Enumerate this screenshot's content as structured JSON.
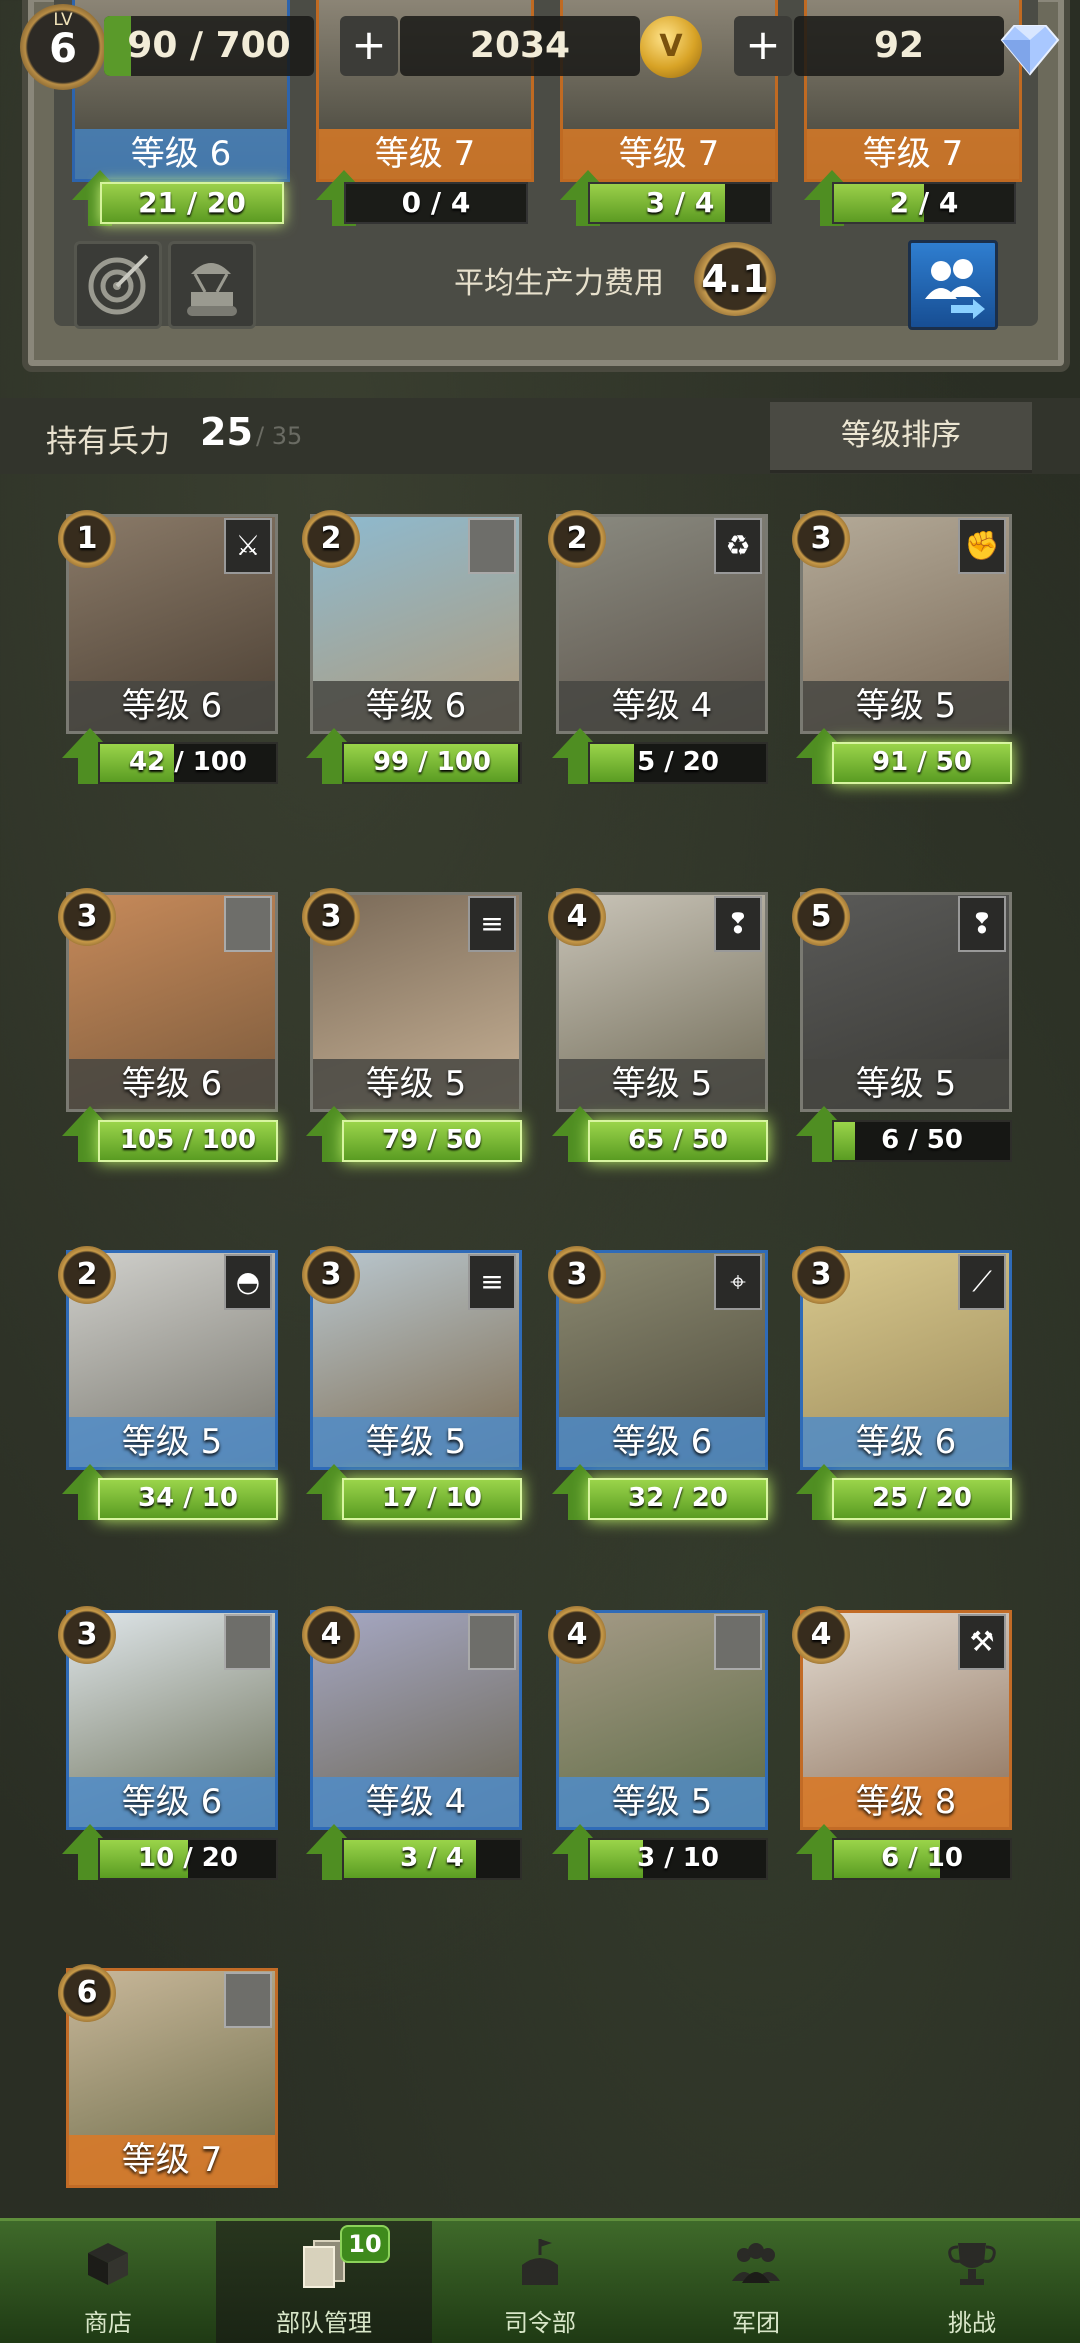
{
  "player": {
    "lv_label": "LV",
    "level": "6",
    "xp": "90 / 700",
    "xp_fraction": 0.13
  },
  "currency": {
    "gold": "2034",
    "diamonds": "92",
    "plus": "+",
    "coin_symbol": "V"
  },
  "deck": {
    "cards": [
      {
        "level": "等级 6",
        "progress": "21 / 20",
        "fraction": 1.0,
        "frame": "blue",
        "ready": true
      },
      {
        "level": "等级 7",
        "progress": "0 / 4",
        "fraction": 0.0,
        "frame": "orange",
        "ready": false
      },
      {
        "level": "等级 7",
        "progress": "3 / 4",
        "fraction": 0.75,
        "frame": "orange",
        "ready": false
      },
      {
        "level": "等级 7",
        "progress": "2 / 4",
        "fraction": 0.5,
        "frame": "orange",
        "ready": false
      }
    ],
    "cost_label": "平均生产力费用",
    "avg_cost": "4.1"
  },
  "roster": {
    "label": "持有兵力",
    "count": "25",
    "max": "/ 35",
    "sort_label": "等级排序"
  },
  "units": [
    {
      "cost": "1",
      "role": "⚔",
      "level": "等级 6",
      "progress": "42 / 100",
      "fraction": 0.42,
      "frame": "grey",
      "ready": false,
      "art": [
        "#8a7a68",
        "#4b3f33"
      ]
    },
    {
      "cost": "2",
      "role": "",
      "level": "等级 6",
      "progress": "99 / 100",
      "fraction": 0.99,
      "frame": "grey",
      "ready": false,
      "art": [
        "#8dbad0",
        "#b09a7a"
      ]
    },
    {
      "cost": "2",
      "role": "♻",
      "level": "等级 4",
      "progress": "5 / 20",
      "fraction": 0.25,
      "frame": "grey",
      "ready": false,
      "art": [
        "#8a8a80",
        "#5a5148"
      ]
    },
    {
      "cost": "3",
      "role": "✊",
      "level": "等级 5",
      "progress": "91 / 50",
      "fraction": 1.0,
      "frame": "grey",
      "ready": true,
      "art": [
        "#b4aa98",
        "#7a6a58"
      ]
    },
    {
      "cost": "3",
      "role": "",
      "level": "等级 6",
      "progress": "105 / 100",
      "fraction": 1.0,
      "frame": "grey",
      "ready": true,
      "art": [
        "#c78a5a",
        "#7a5a3c"
      ]
    },
    {
      "cost": "3",
      "role": "≡",
      "level": "等级 5",
      "progress": "79 / 50",
      "fraction": 1.0,
      "frame": "grey",
      "ready": true,
      "art": [
        "#7a6a58",
        "#c8b296"
      ]
    },
    {
      "cost": "4",
      "role": "❢",
      "level": "等级 5",
      "progress": "65 / 50",
      "fraction": 1.0,
      "frame": "grey",
      "ready": true,
      "art": [
        "#c9c4b8",
        "#6f6a56"
      ]
    },
    {
      "cost": "5",
      "role": "❢",
      "level": "等级 5",
      "progress": "6 / 50",
      "fraction": 0.12,
      "frame": "grey",
      "ready": false,
      "art": [
        "#5a5a58",
        "#3a3a36"
      ]
    },
    {
      "cost": "2",
      "role": "◓",
      "level": "等级 5",
      "progress": "34 / 10",
      "fraction": 1.0,
      "frame": "blue",
      "ready": true,
      "art": [
        "#d0d0cc",
        "#77756c"
      ]
    },
    {
      "cost": "3",
      "role": "≡",
      "level": "等级 5",
      "progress": "17 / 10",
      "fraction": 1.0,
      "frame": "blue",
      "ready": true,
      "art": [
        "#b9c7cf",
        "#7d6a4e"
      ]
    },
    {
      "cost": "3",
      "role": "⌖",
      "level": "等级 6",
      "progress": "32 / 20",
      "fraction": 1.0,
      "frame": "blue",
      "ready": true,
      "art": [
        "#8c8a72",
        "#4d4a3a"
      ]
    },
    {
      "cost": "3",
      "role": "⟋",
      "level": "等级 6",
      "progress": "25 / 20",
      "fraction": 1.0,
      "frame": "blue",
      "ready": true,
      "art": [
        "#d9c98e",
        "#9b8a5a"
      ]
    },
    {
      "cost": "3",
      "role": "",
      "level": "等级 6",
      "progress": "10 / 20",
      "fraction": 0.5,
      "frame": "blue",
      "ready": false,
      "art": [
        "#dfe6ea",
        "#6a6e55"
      ]
    },
    {
      "cost": "4",
      "role": "",
      "level": "等级 4",
      "progress": "3 / 4",
      "fraction": 0.75,
      "frame": "blue",
      "ready": false,
      "art": [
        "#a6a8c4",
        "#6a6450"
      ]
    },
    {
      "cost": "4",
      "role": "",
      "level": "等级 5",
      "progress": "3 / 10",
      "fraction": 0.3,
      "frame": "blue",
      "ready": false,
      "art": [
        "#a49a86",
        "#5c6a44"
      ]
    },
    {
      "cost": "4",
      "role": "⚒",
      "level": "等级 8",
      "progress": "6 / 10",
      "fraction": 0.6,
      "frame": "orange",
      "ready": false,
      "art": [
        "#e4dcd2",
        "#8a6e58"
      ]
    },
    {
      "cost": "6",
      "role": "",
      "level": "等级 7",
      "progress": "",
      "fraction": 0,
      "frame": "orange",
      "ready": false,
      "art": [
        "#c9b89a",
        "#6a6a48"
      ]
    }
  ],
  "nav": {
    "items": [
      {
        "label": "商店",
        "icon": "box-icon"
      },
      {
        "label": "部队管理",
        "icon": "cards-icon",
        "badge": "10"
      },
      {
        "label": "司令部",
        "icon": "hq-icon"
      },
      {
        "label": "军团",
        "icon": "group-icon"
      },
      {
        "label": "挑战",
        "icon": "trophy-icon"
      }
    ]
  }
}
